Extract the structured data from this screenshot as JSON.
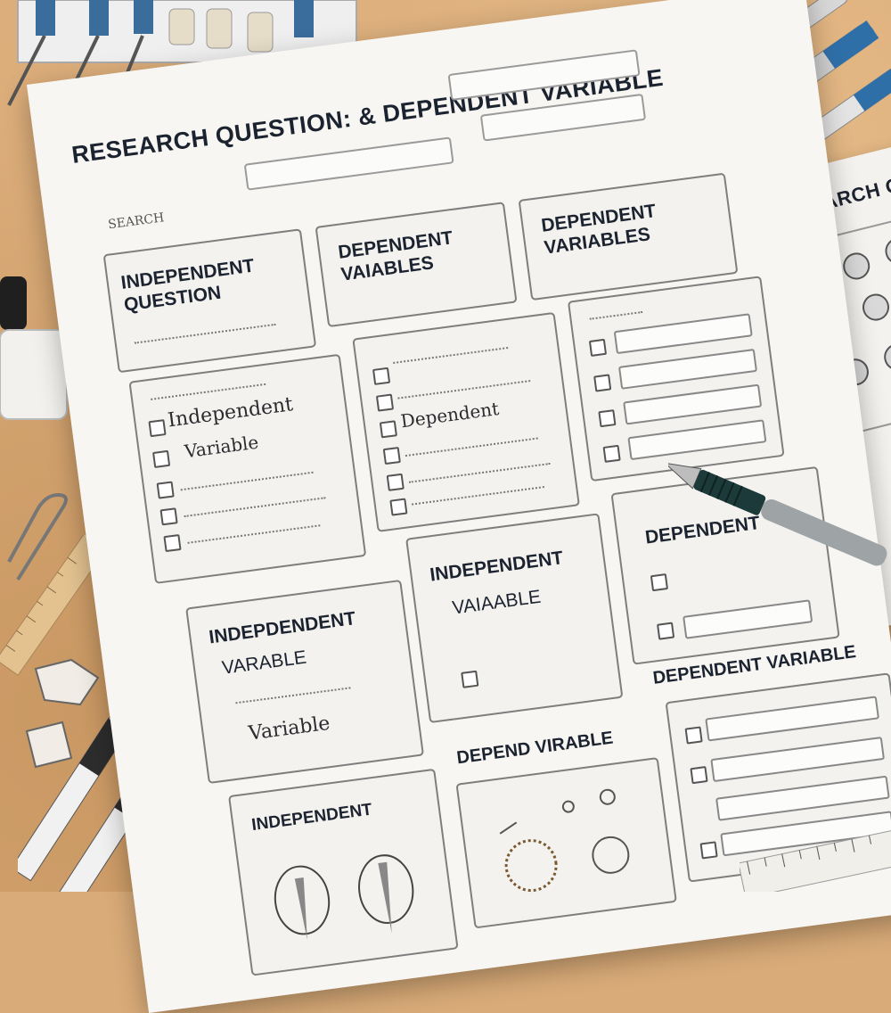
{
  "sheet": {
    "title": "RESEARCH QUESTION: & DEPENDENT VARIABLE",
    "search_label": "SEARCH",
    "boxes": {
      "b1_heading": "INDEPENDENT QUESTION",
      "b2_heading": "DEPENDENT VAIABLES",
      "b3_heading": "DEPENDENT VARIABLES",
      "b4_hand_1": "Independent",
      "b4_hand_2": "Variable",
      "b5_hand": "Dependent",
      "b7_heading": "DEPENDENT",
      "b8_heading_1": "INDEPDENDENT",
      "b8_heading_2": "VARABLE",
      "b8_hand": "Variable",
      "b9_heading": "INDEPENDENT",
      "b9_sub": "VAIAABLE",
      "b10_heading": "DEPENDENT VARIABLE",
      "b11_heading": "INDEPENDENT",
      "b12_heading": "DEPEND VIRABLE"
    }
  },
  "sheet2": {
    "title": "RESEARCH QU"
  }
}
